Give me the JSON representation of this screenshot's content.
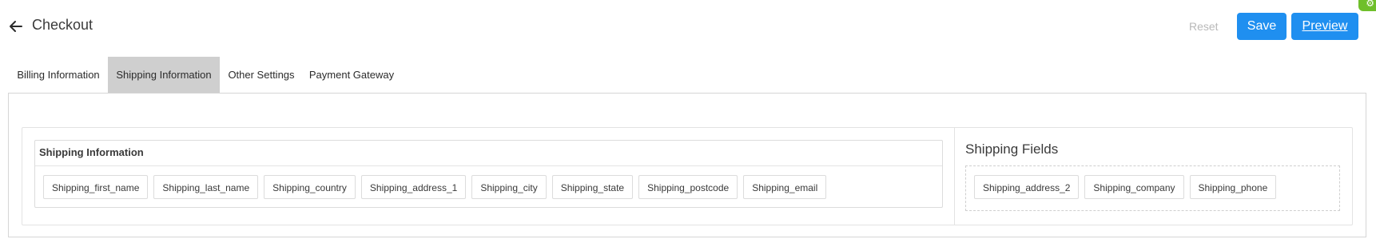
{
  "header": {
    "title": "Checkout",
    "reset_label": "Reset",
    "save_label": "Save",
    "preview_label": "Preview"
  },
  "tabs": [
    {
      "label": "Billing Information",
      "active": false
    },
    {
      "label": "Shipping Information",
      "active": true
    },
    {
      "label": "Other Settings",
      "active": false
    },
    {
      "label": "Payment Gateway",
      "active": false
    }
  ],
  "shipping_card": {
    "title": "Shipping Information",
    "fields": [
      "Shipping_first_name",
      "Shipping_last_name",
      "Shipping_country",
      "Shipping_address_1",
      "Shipping_city",
      "Shipping_state",
      "Shipping_postcode",
      "Shipping_email"
    ]
  },
  "shipping_fields": {
    "title": "Shipping Fields",
    "fields": [
      "Shipping_address_2",
      "Shipping_company",
      "Shipping_phone"
    ]
  },
  "colors": {
    "accent": "#1f8ff0",
    "active_tab": "#cfcfcf",
    "badge": "#6fbf2a"
  },
  "icons": {
    "back": "arrow-left-icon",
    "badge": "gear-icon"
  }
}
